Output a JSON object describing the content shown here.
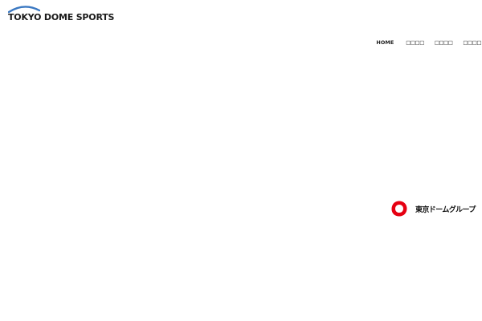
{
  "header": {
    "logo_text": "TOKYO DOME SPORTS",
    "brand_color": "#3a78c2"
  },
  "nav": {
    "home_label": "HOME",
    "items": [
      {
        "label": "□□□□"
      },
      {
        "label": "□□□□"
      },
      {
        "label": "□□□□"
      }
    ]
  },
  "group_logo": {
    "text": "東京ドームグループ",
    "mark_color": "#e60012"
  }
}
